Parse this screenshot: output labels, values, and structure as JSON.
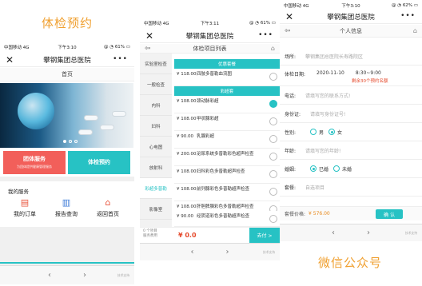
{
  "captions": {
    "p1": "体检预约",
    "p3": "微信公众号"
  },
  "status": {
    "carrier": "中国移动",
    "net": "4G",
    "time1": "下午3:10",
    "time2": "下午3:11",
    "time3": "下午3:10",
    "batt1": "61%",
    "batt2": "61%",
    "batt3": "62%",
    "icons": "@ ◔"
  },
  "p1": {
    "title": "攀钢集团总医院",
    "subtitle": "首页",
    "tiles": [
      {
        "title": "团体服务",
        "sub": "为团体提供健康管理服务",
        "color": "#f25f5a"
      },
      {
        "title": "体检预约",
        "sub": "",
        "color": "#27c2c4"
      }
    ],
    "services_title": "我的服务",
    "services": [
      {
        "label": "我的订单",
        "icon": "clipboard-icon",
        "glyph": "▤",
        "color": "#e9573f"
      },
      {
        "label": "报告查询",
        "icon": "report-icon",
        "glyph": "▥",
        "color": "#3d7bd8"
      },
      {
        "label": "返回首页",
        "icon": "home-icon",
        "glyph": "⌂",
        "color": "#e9573f"
      }
    ],
    "footer_right": "技术支持"
  },
  "p2": {
    "title": "攀钢集团总医院",
    "subtitle": "体检项目列表",
    "categories": [
      "实验室检查",
      "一般检查",
      "内科",
      "妇科",
      "心电图",
      "放射科",
      "彩超多普勒",
      "影像室",
      "外科"
    ],
    "active_category": 6,
    "groups": [
      {
        "label": "优惠套餐"
      },
      {
        "label": "彩超套"
      }
    ],
    "items": [
      {
        "price": "¥ 118.00",
        "name": "四肢多普勒血流图",
        "checked": false
      },
      {
        "price": "¥ 108.00",
        "name": "颈动脉彩超",
        "checked": true
      },
      {
        "price": "¥ 108.00",
        "name": "甲状腺彩超",
        "checked": false
      },
      {
        "price": "¥ 90.00",
        "name": "乳腺彩超",
        "checked": false
      },
      {
        "price": "¥ 200.00",
        "name": "泌尿系统多普勒彩色超声检查",
        "checked": false
      },
      {
        "price": "¥ 108.00",
        "name": "妇科彩色多普勒超声检查",
        "checked": false
      },
      {
        "price": "¥ 108.00",
        "name": "前列腺彩色多普勒超声检查",
        "checked": false
      },
      {
        "price": "¥ 108.00",
        "name": "肝胆脾胰彩色多普勒超声检查",
        "checked": false
      },
      {
        "price": "¥ 90.00",
        "name": "经阴道彩色多普勒超声检查",
        "checked": false
      }
    ],
    "count_label": "0 个项目",
    "count_label2": "服务费用",
    "total": "¥ 0.0",
    "go_label": "去付 >",
    "footer_right": "技术支持"
  },
  "p3": {
    "title": "攀钢集团总医院",
    "subtitle": "个人信息",
    "fields": [
      {
        "key": "场所:",
        "value": "攀钢集团总医院长寿路院区",
        "dark": false
      },
      {
        "key": "体检日期:",
        "value": "2020-11-10",
        "value2": "8:30~9:00",
        "note": "剩余30个预约名额",
        "dark": true
      },
      {
        "key": "电话:",
        "value": "请填写您的联系方式!",
        "dark": false
      },
      {
        "key": "身份证:",
        "value": "请填写身份证号!",
        "dark": false
      },
      {
        "key": "性别:",
        "opt1": "男",
        "opt2": "女",
        "sel": 2,
        "radio": true
      },
      {
        "key": "年龄:",
        "value": "请填写您的年龄!",
        "dark": false
      },
      {
        "key": "婚姻:",
        "opt1": "已婚",
        "opt2": "未婚",
        "sel": 1,
        "radio": true
      },
      {
        "key": "套餐:",
        "value": "自选项目",
        "dark": false
      }
    ],
    "price_label": "套餐价格:",
    "price": "¥ 576.00",
    "confirm": "确 认",
    "footer_right": "技术支持"
  }
}
